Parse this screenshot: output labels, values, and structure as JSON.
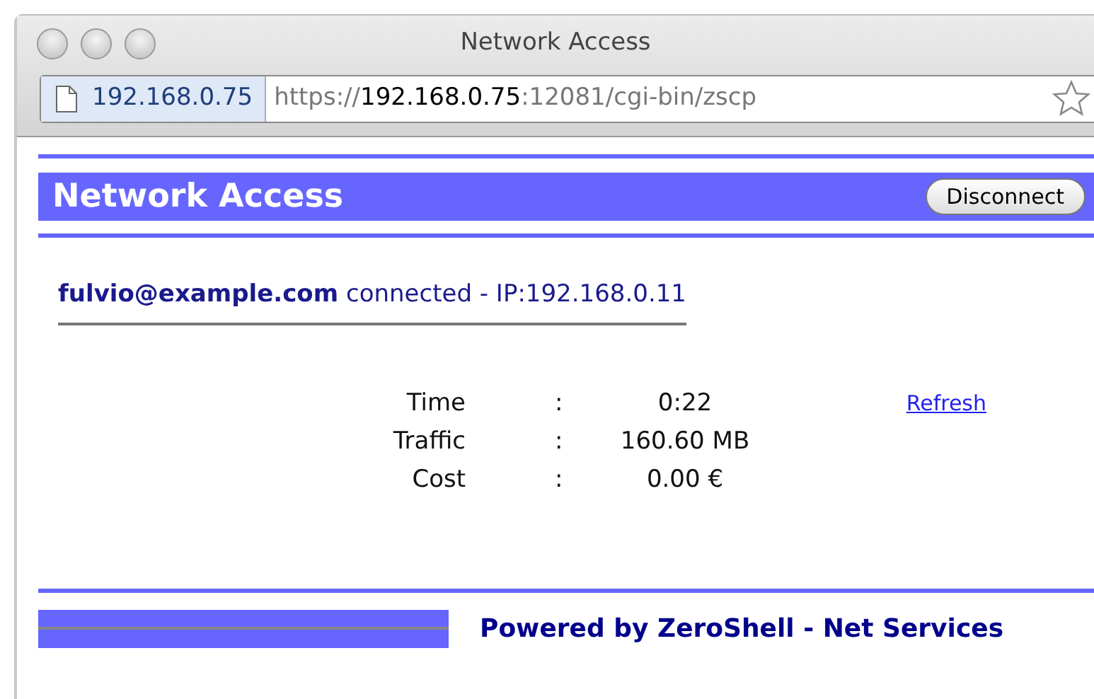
{
  "window": {
    "title": "Network Access"
  },
  "address_bar": {
    "site": "192.168.0.75",
    "url_scheme": "https://",
    "url_host": "192.168.0.75",
    "url_path": ":12081/cgi-bin/zscp"
  },
  "header": {
    "title": "Network Access",
    "button": "Disconnect"
  },
  "status": "**fulvio@example.com** connected - IP:192.168.0.11",
  "stats": [
    {
      "label": "Time",
      "separator": ":",
      "value": "0:22"
    },
    {
      "label": "Traffic",
      "separator": ":",
      "value": "160.60 MB"
    },
    {
      "label": "Cost",
      "separator": ":",
      "value": "0.00 €"
    }
  ],
  "refresh_link": "Refresh",
  "footer": "Powered by ZeroShell - Net Services"
}
